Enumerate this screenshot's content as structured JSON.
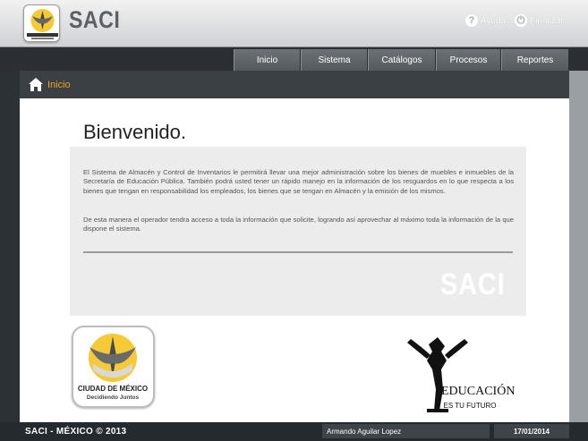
{
  "header": {
    "app_name": "SACI",
    "help_label": "Ayuda",
    "logout_label": "Finalizar"
  },
  "nav": {
    "items": [
      "Inicio",
      "Sistema",
      "Catálogos",
      "Procesos",
      "Reportes"
    ]
  },
  "breadcrumb": {
    "current": "Inicio"
  },
  "main": {
    "title": "Bienvenido.",
    "paragraph1": "El Sistema de Almacén y Control de Inventarios le permitirá llevar una mejor administración sobre los bienes de muebles e inmuebles de la Secretaría de Educación Pública. También podrá usted tener un rápido manejo en la información de los resguardos en lo que respecta a los bienes que tengan en responsabilidad los empleados, los bienes que se tengan en Almacén y la emisión de los mismos.",
    "paragraph2": "De esta manera el operador tendra acceso a toda la información que solicite, logrando así aprovechar al máximo toda la información de la que dispone el sistema.",
    "watermark": "SACI"
  },
  "logos": {
    "city_line1": "CIUDAD DE MÉXICO",
    "city_line2": "Decidiendo Juntos",
    "edu_line1": "EDUCACIÓN",
    "edu_line2": "ES TU FUTURO"
  },
  "footer": {
    "copyright": "SACI - MÉXICO © 2013",
    "user": "Armando Aguilar Lopez",
    "date": "17/01/2014"
  },
  "colors": {
    "accent_orange": "#f0a424",
    "nav_dark": "#2b2f33",
    "panel_gray": "#ececec"
  }
}
